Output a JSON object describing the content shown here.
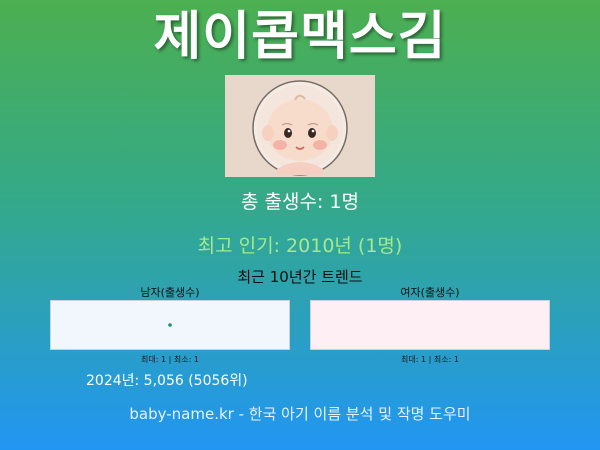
{
  "name": "제이콥맥스김",
  "total_births": "총 출생수: 1명",
  "most_popular": "최고 인기: 2010년 (1명)",
  "trend_title": "최근 10년간 트렌드",
  "male_chart": {
    "label": "남자(출생수)",
    "stats": "최대: 1 | 최소: 1",
    "color": "#1a8f7a"
  },
  "female_chart": {
    "label": "여자(출생수)",
    "stats": "최대: 1 | 최소: 1"
  },
  "year_summary": "2024년: 5,056 (5056위)",
  "footer": "baby-name.kr - 한국 아기 이름 분석 및 작명 도우미",
  "chart_data": [
    {
      "type": "line",
      "title": "남자(출생수)",
      "series": [
        {
          "values": [
            1
          ]
        }
      ],
      "annotations": [
        "최대: 1 | 최소: 1"
      ]
    },
    {
      "type": "line",
      "title": "여자(출생수)",
      "series": [],
      "annotations": [
        "최대: 1 | 최소: 1"
      ]
    }
  ]
}
